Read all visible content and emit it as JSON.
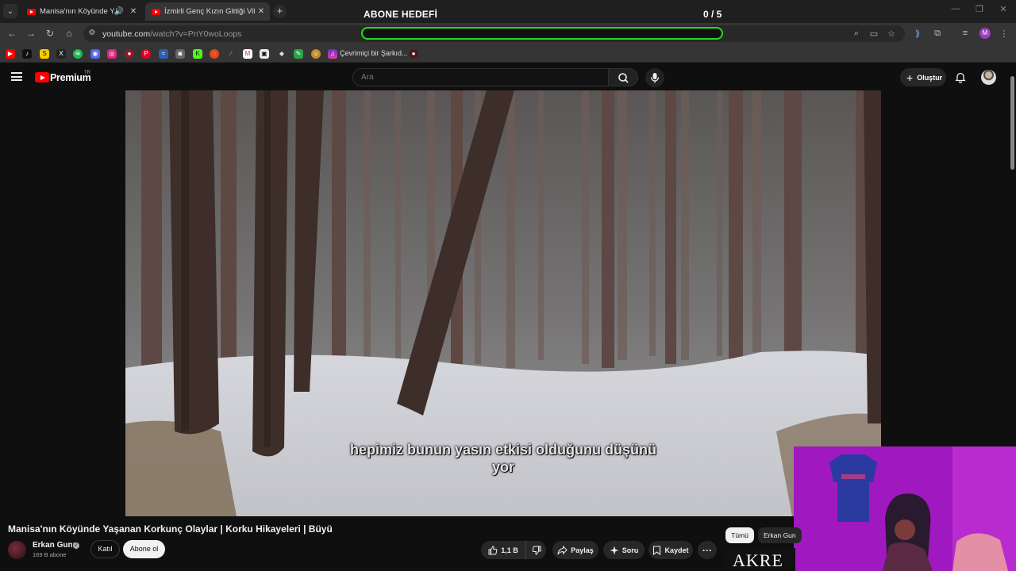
{
  "browser": {
    "tabs": [
      {
        "title": "Manisa'nın Köyünde Yaşanan",
        "active": false
      },
      {
        "title": "İzmirli Genç Kızın Gittiği Villada",
        "active": true
      }
    ],
    "url_host": "youtube.com",
    "url_path": "/watch?v=PnY0woLoops",
    "bookmark_label": "Çevrimiçi bir Şarkıd...",
    "profile_initial": "M"
  },
  "overlay": {
    "goal_title": "ABONE HEDEFİ",
    "goal_count": "0 / 5",
    "goal_progress": 0,
    "bar_color": "#22dd22"
  },
  "youtube": {
    "brand": "Premium",
    "country": "TR",
    "search_placeholder": "Ara",
    "create_label": "Oluştur"
  },
  "video": {
    "subtitle_line1": "hepimiz bunun yasın etkisi olduğunu düşünü",
    "subtitle_line2": "yor",
    "title": "Manisa'nın Köyünde Yaşanan Korkunç Olaylar | Korku Hikayeleri | Büyü",
    "channel": "Erkan Gunn",
    "subscribers": "169 B abone",
    "join_label": "Katıl",
    "subscribe_label": "Abone ol",
    "likes": "1,1 B",
    "share_label": "Paylaş",
    "ask_label": "Soru",
    "save_label": "Kaydet"
  },
  "recommendations": {
    "chip_all": "Tümü",
    "chip_channel": "Erkan Gun",
    "thumb_text": "AKRE"
  }
}
